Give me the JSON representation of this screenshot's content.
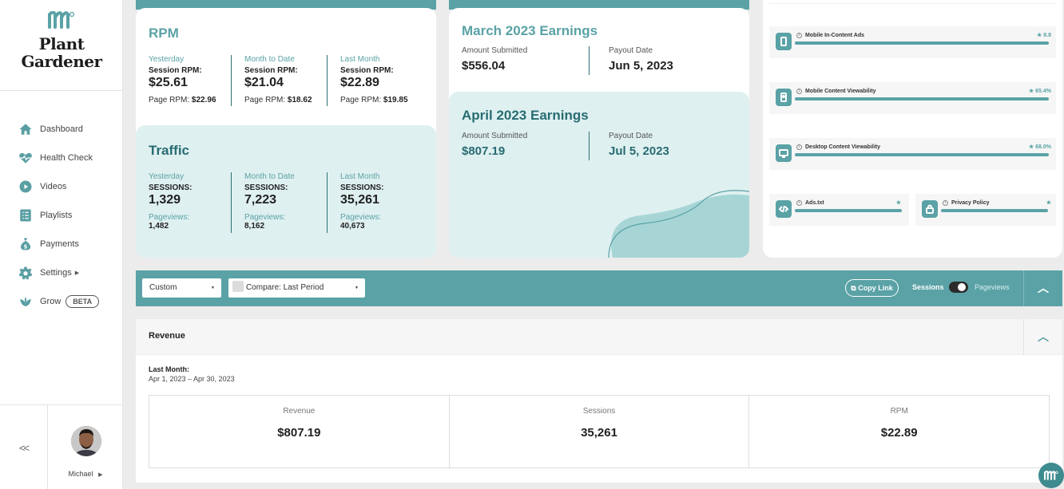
{
  "brand": {
    "name_line1": "Plant",
    "name_line2": "Gardener"
  },
  "sidebar": {
    "items": [
      {
        "label": "Dashboard",
        "icon": "home-icon"
      },
      {
        "label": "Health Check",
        "icon": "heart-pulse-icon"
      },
      {
        "label": "Videos",
        "icon": "play-icon"
      },
      {
        "label": "Playlists",
        "icon": "list-icon"
      },
      {
        "label": "Payments",
        "icon": "money-bag-icon"
      },
      {
        "label": "Settings",
        "icon": "gear-icon"
      },
      {
        "label": "Grow",
        "icon": "leaf-icon",
        "badge": "BETA"
      }
    ],
    "collapse_label": "<<",
    "user_name": "Michael"
  },
  "rpm": {
    "title": "RPM",
    "columns": [
      {
        "period": "Yesterday",
        "session_label": "Session RPM:",
        "session_value": "$25.61",
        "page_label": "Page RPM:",
        "page_value": "$22.96"
      },
      {
        "period": "Month to Date",
        "session_label": "Session RPM:",
        "session_value": "$21.04",
        "page_label": "Page RPM:",
        "page_value": "$18.62"
      },
      {
        "period": "Last Month",
        "session_label": "Session RPM:",
        "session_value": "$22.89",
        "page_label": "Page RPM:",
        "page_value": "$19.85"
      }
    ]
  },
  "traffic": {
    "title": "Traffic",
    "columns": [
      {
        "period": "Yesterday",
        "sessions_label": "SESSIONS:",
        "sessions_value": "1,329",
        "pageviews_label": "Pageviews:",
        "pageviews_value": "1,482"
      },
      {
        "period": "Month to Date",
        "sessions_label": "SESSIONS:",
        "sessions_value": "7,223",
        "pageviews_label": "Pageviews:",
        "pageviews_value": "8,162"
      },
      {
        "period": "Last Month",
        "sessions_label": "SESSIONS:",
        "sessions_value": "35,261",
        "pageviews_label": "Pageviews:",
        "pageviews_value": "40,673"
      }
    ]
  },
  "earnings": [
    {
      "title": "March 2023 Earnings",
      "amount_label": "Amount Submitted",
      "amount": "$556.04",
      "payout_label": "Payout Date",
      "payout": "Jun 5, 2023"
    },
    {
      "title": "April 2023 Earnings",
      "amount_label": "Amount Submitted",
      "amount": "$807.19",
      "payout_label": "Payout Date",
      "payout": "Jul 5, 2023"
    }
  ],
  "health": [
    {
      "name": "Mobile In-Content Ads",
      "score": "8.8",
      "icon": "mobile-icon",
      "level_pct": 100
    },
    {
      "name": "Mobile Content Viewability",
      "score": "65.4%",
      "icon": "mobile-eye-icon",
      "level_pct": 100
    },
    {
      "name": "Desktop Content Viewability",
      "score": "68.0%",
      "icon": "desktop-icon",
      "level_pct": 100
    },
    {
      "name": "Ads.txt",
      "score": "",
      "icon": "code-icon",
      "level_pct": 100
    },
    {
      "name": "Privacy Policy",
      "score": "",
      "icon": "lock-icon",
      "level_pct": 100
    }
  ],
  "filters": {
    "range": "Custom",
    "compare": "Compare: Last Period",
    "copy_link": "Copy Link",
    "toggle_left": "Sessions",
    "toggle_right": "Pageviews"
  },
  "revenue": {
    "title": "Revenue",
    "period_label": "Last Month:",
    "period_range": "Apr 1, 2023 – Apr 30, 2023",
    "metrics": [
      {
        "label": "Revenue",
        "value": "$807.19"
      },
      {
        "label": "Sessions",
        "value": "35,261"
      },
      {
        "label": "RPM",
        "value": "$22.89"
      }
    ]
  },
  "colors": {
    "accent": "#5aa2a6",
    "accent_dark": "#286c72",
    "panel_teal": "#dff0f0"
  }
}
